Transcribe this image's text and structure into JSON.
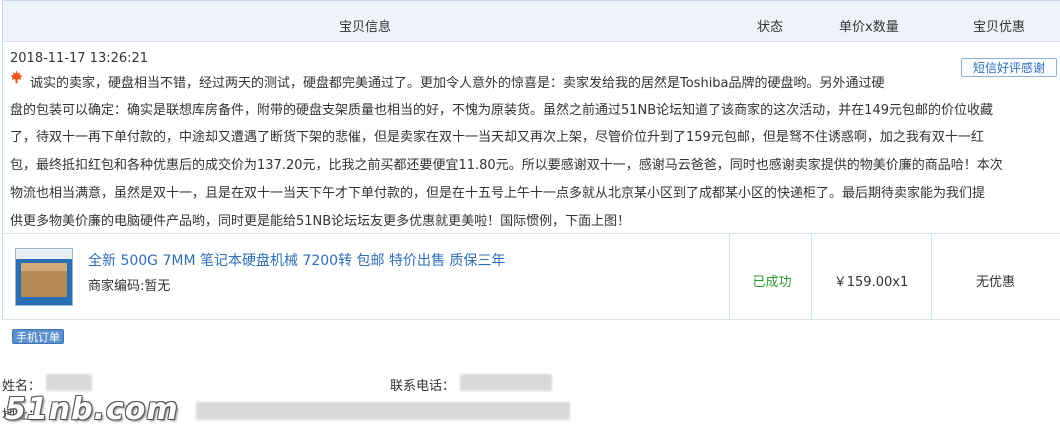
{
  "table_header": {
    "item_info": "宝贝信息",
    "status": "状态",
    "unit_price_qty": "单价x数量",
    "discount": "宝贝优惠"
  },
  "review": {
    "timestamp": "2018-11-17 13:26:21",
    "sms_button": "短信好评感谢",
    "lines": [
      "诚实的卖家，硬盘相当不错，经过两天的测试，硬盘都完美通过了。更加令人意外的惊喜是：卖家发给我的居然是Toshiba品牌的硬盘哟。另外通过硬",
      "盘的包装可以确定：确实是联想库房备件，附带的硬盘支架质量也相当的好，不愧为原装货。虽然之前通过51NB论坛知道了该商家的这次活动，并在149元包邮的价位收藏",
      "了，待双十一再下单付款的，中途却又遭遇了断货下架的悲催，但是卖家在双十一当天却又再次上架，尽管价位升到了159元包邮，但是驽不住诱惑啊，加之我有双十一红",
      "包，最终抵扣红包和各种优惠后的成交价为137.20元，比我之前买都还要便宜11.80元。所以要感谢双十一，感谢马云爸爸，同时也感谢卖家提供的物美价廉的商品哈！本次",
      "物流也相当满意，虽然是双十一，且是在双十一当天下午才下单付款的，但是在十五号上午十一点多就从北京某小区到了成都某小区的快递柜了。最后期待卖家能为我们提",
      "供更多物美价廉的电脑硬件产品哟，同时更是能给51NB论坛坛友更多优惠就更美啦！国际惯例，下面上图！"
    ]
  },
  "order_item": {
    "title": "全新 500G 7MM 笔记本硬盘机械 7200转 包邮 特价出售 质保三年",
    "merchant_code": "商家编码:暂无",
    "status": "已成功",
    "price_qty": "￥159.00x1",
    "discount": "无优惠"
  },
  "mobile_order_badge": "手机订单",
  "buyer": {
    "name_label": "姓名：",
    "phone_label": "联系电话：",
    "address_label": "地址："
  },
  "watermark": "51nb.com",
  "colors": {
    "header_bg": "#eef3fa",
    "border": "#d8e3ef",
    "link": "#2f6eb6",
    "success": "#2e9a2e",
    "badge_bg": "#5b8fcc"
  },
  "icons": {
    "review_icon": "maple-leaf-icon"
  }
}
